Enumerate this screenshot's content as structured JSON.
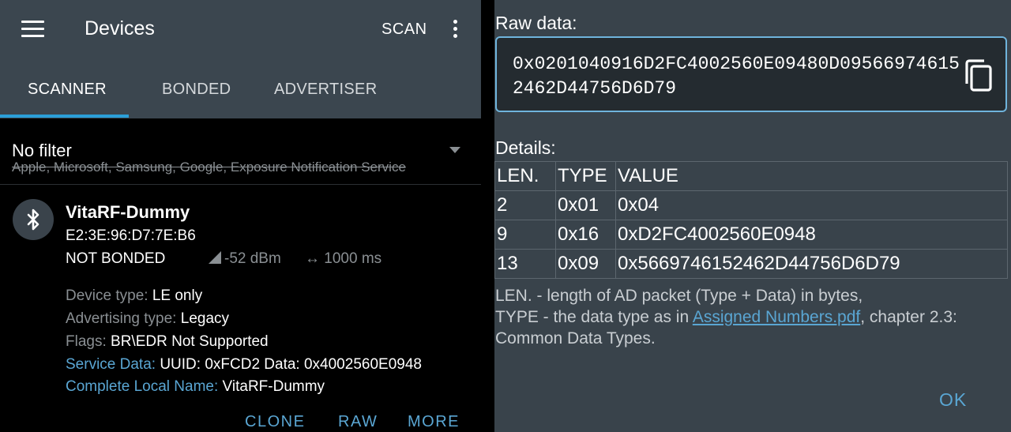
{
  "toolbar": {
    "title": "Devices",
    "scan_label": "SCAN"
  },
  "tabs": [
    {
      "label": "SCANNER",
      "active": true
    },
    {
      "label": "BONDED",
      "active": false
    },
    {
      "label": "ADVERTISER",
      "active": false
    }
  ],
  "filter": {
    "title": "No filter",
    "subtitle": "Apple, Microsoft, Samsung, Google, Exposure Notification Service"
  },
  "device": {
    "name": "VitaRF-Dummy",
    "mac": "E2:3E:96:D7:7E:B6",
    "bond_state": "NOT BONDED",
    "rssi": "-52 dBm",
    "interval": "1000 ms",
    "details": [
      {
        "label": "Device type:",
        "value": "LE only",
        "label_color": "grey"
      },
      {
        "label": "Advertising type:",
        "value": "Legacy",
        "label_color": "grey"
      },
      {
        "label": "Flags:",
        "value": "BR\\EDR Not Supported",
        "label_color": "grey"
      },
      {
        "label": "Service Data:",
        "value": "UUID: 0xFCD2 Data: 0x4002560E0948",
        "label_color": "blue"
      },
      {
        "label": "Complete Local Name:",
        "value": "VitaRF-Dummy",
        "label_color": "blue"
      }
    ],
    "actions": {
      "clone": "CLONE",
      "raw": "RAW",
      "more": "MORE"
    }
  },
  "raw_dialog": {
    "raw_label": "Raw data:",
    "raw_value": "0x0201040916D2FC4002560E09480D095669746152462D44756D6D79",
    "details_label": "Details:",
    "table_headers": [
      "LEN.",
      "TYPE",
      "VALUE"
    ],
    "table_rows": [
      [
        "2",
        "0x01",
        "0x04"
      ],
      [
        "9",
        "0x16",
        "0xD2FC4002560E0948"
      ],
      [
        "13",
        "0x09",
        "0x5669746152462D44756D6D79"
      ]
    ],
    "legend_line1": "LEN. - length of AD packet (Type + Data) in bytes,",
    "legend_line2_pre": "TYPE - the data type as in ",
    "legend_link": "Assigned Numbers.pdf",
    "legend_line2_post": ", chapter 2.3:",
    "legend_line3": "Common Data Types.",
    "ok_label": "OK"
  },
  "colors": {
    "toolbar_bg": "#3b464f",
    "accent_blue": "#2b9fd8",
    "link_blue": "#5aa6d3",
    "dialog_bg": "#39434b"
  },
  "icons": [
    "menu-icon",
    "overflow-menu-icon",
    "dropdown-arrow-icon",
    "bluetooth-icon",
    "signal-strength-icon",
    "interval-arrows-icon",
    "copy-icon"
  ]
}
